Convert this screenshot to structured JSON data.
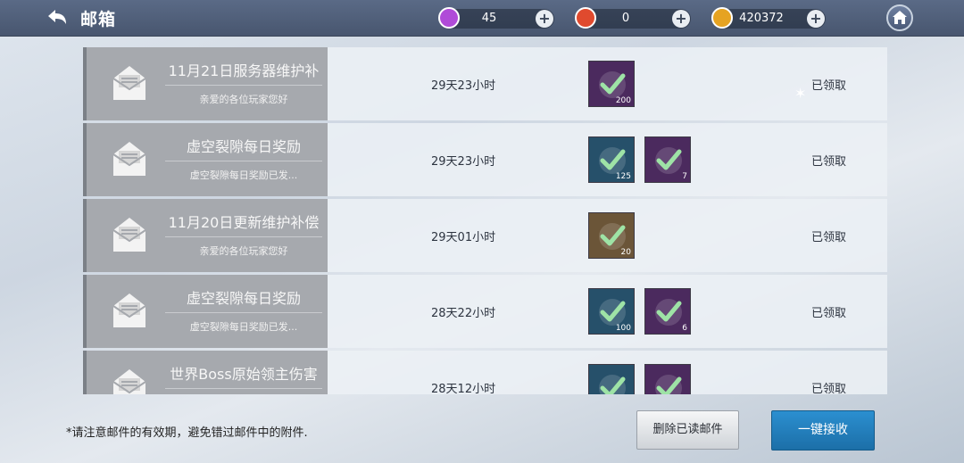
{
  "header": {
    "title": "邮箱",
    "currencies": [
      {
        "name": "purple-gem-icon",
        "value": "45",
        "color": "#b04bd8"
      },
      {
        "name": "red-flame-icon",
        "value": "0",
        "color": "#e04a2e"
      },
      {
        "name": "gold-coin-icon",
        "value": "420372",
        "color": "#e6a322"
      }
    ]
  },
  "mails": [
    {
      "subject": "11月21日服务器维护补",
      "preview": "亲爱的各位玩家您好",
      "expiry": "29天23小时",
      "status": "已领取",
      "items": [
        {
          "type": "purple",
          "qty": "200"
        }
      ]
    },
    {
      "subject": "虚空裂隙每日奖励",
      "preview": "虚空裂隙每日奖励已发...",
      "expiry": "29天23小时",
      "status": "已领取",
      "items": [
        {
          "type": "teal",
          "qty": "125"
        },
        {
          "type": "purple",
          "qty": "7"
        }
      ]
    },
    {
      "subject": "11月20日更新维护补偿",
      "preview": "亲爱的各位玩家您好",
      "expiry": "29天01小时",
      "status": "已领取",
      "items": [
        {
          "type": "brown",
          "qty": "20"
        }
      ]
    },
    {
      "subject": "虚空裂隙每日奖励",
      "preview": "虚空裂隙每日奖励已发...",
      "expiry": "28天22小时",
      "status": "已领取",
      "items": [
        {
          "type": "teal",
          "qty": "100"
        },
        {
          "type": "purple",
          "qty": "6"
        }
      ]
    },
    {
      "subject": "世界Boss原始领主伤害",
      "preview": "",
      "expiry": "28天12小时",
      "status": "已领取",
      "items": [
        {
          "type": "teal",
          "qty": ""
        },
        {
          "type": "purple",
          "qty": ""
        }
      ]
    }
  ],
  "footer": {
    "notice": "*请注意邮件的有效期，避免错过邮件中的附件.",
    "delete_label": "删除已读邮件",
    "claim_label": "一键接收"
  },
  "colors": {
    "item_purple": "#4b2a5e",
    "item_teal": "#26506a",
    "item_brown": "#6b5538",
    "accent_blue": "#2282c0"
  }
}
